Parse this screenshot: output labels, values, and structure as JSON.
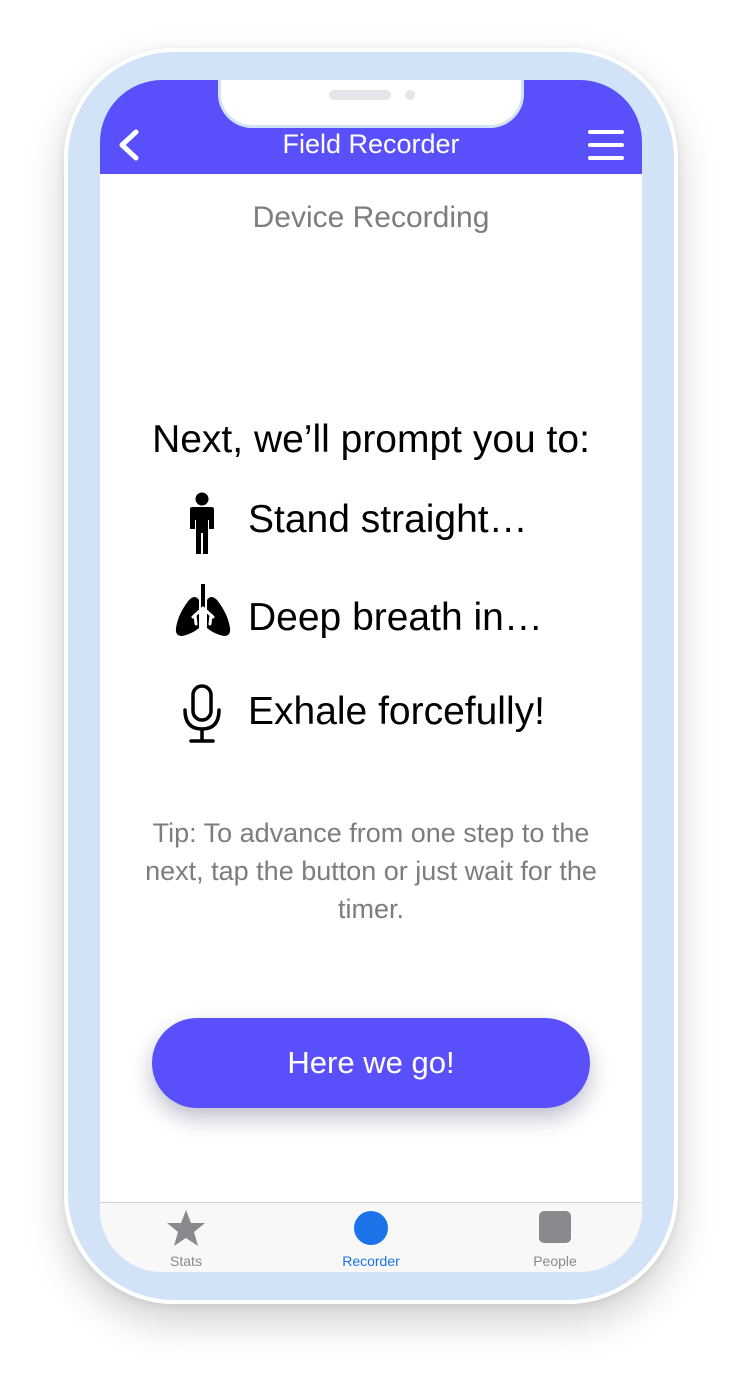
{
  "header": {
    "title": "Field Recorder"
  },
  "page": {
    "heading": "Device Recording",
    "intro": "Next, we’ll prompt you to:",
    "steps": [
      {
        "label": "Stand straight…",
        "icon": "person-standing-icon"
      },
      {
        "label": "Deep breath in…",
        "icon": "lungs-icon"
      },
      {
        "label": "Exhale forcefully!",
        "icon": "microphone-icon"
      }
    ],
    "tip": "Tip: To advance from one step to the next, tap the button or just wait for the timer.",
    "start_button": "Here we go!"
  },
  "tabbar": {
    "tabs": [
      {
        "label": "Stats",
        "icon": "star-icon",
        "active": false
      },
      {
        "label": "Recorder",
        "icon": "circle-icon",
        "active": true
      },
      {
        "label": "People",
        "icon": "square-icon",
        "active": false
      }
    ]
  },
  "colors": {
    "accent": "#5a50fb",
    "frame": "#d2e3f8",
    "active_tab": "#1a73e8",
    "muted_text": "#7d7d80"
  }
}
